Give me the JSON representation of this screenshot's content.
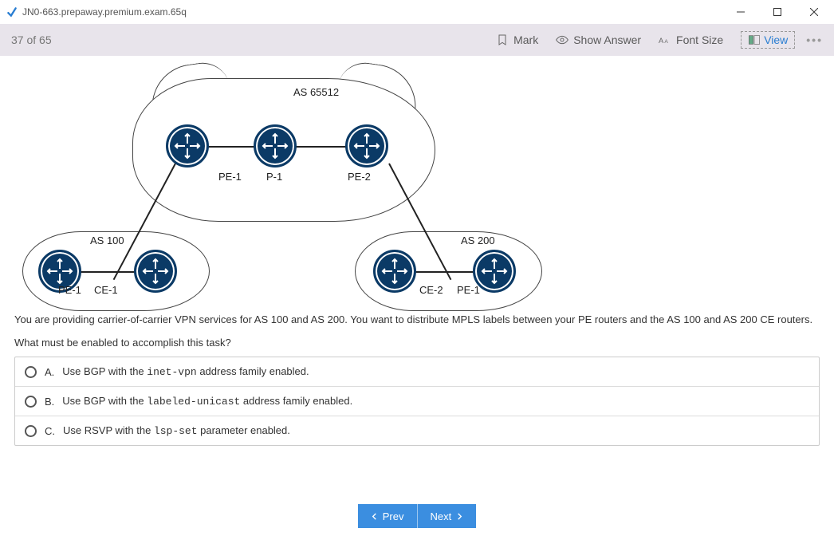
{
  "window": {
    "title": "JN0-663.prepaway.premium.exam.65q"
  },
  "toolbar": {
    "progress": "37 of 65",
    "mark": "Mark",
    "show_answer": "Show Answer",
    "font_size": "Font Size",
    "view": "View"
  },
  "diagram": {
    "as_top": "AS 65512",
    "as_left": "AS 100",
    "as_right": "AS 200",
    "top_routers": [
      "PE-1",
      "P-1",
      "PE-2"
    ],
    "left_routers": [
      "PE-1",
      "CE-1"
    ],
    "right_routers": [
      "CE-2",
      "PE-1"
    ]
  },
  "question": {
    "body": "You are providing carrier-of-carrier VPN services for AS 100 and AS 200. You want to distribute MPLS labels between your PE routers and the AS 100 and AS 200 CE routers.",
    "prompt": "What must be enabled to accomplish this task?"
  },
  "options": [
    {
      "letter": "A.",
      "pre": "Use BGP with the ",
      "code": "inet-vpn",
      "post": " address family enabled."
    },
    {
      "letter": "B.",
      "pre": "Use BGP with the ",
      "code": "labeled-unicast",
      "post": " address family enabled."
    },
    {
      "letter": "C.",
      "pre": "Use RSVP with the ",
      "code": "lsp-set",
      "post": " parameter enabled."
    }
  ],
  "nav": {
    "prev": "Prev",
    "next": "Next"
  }
}
